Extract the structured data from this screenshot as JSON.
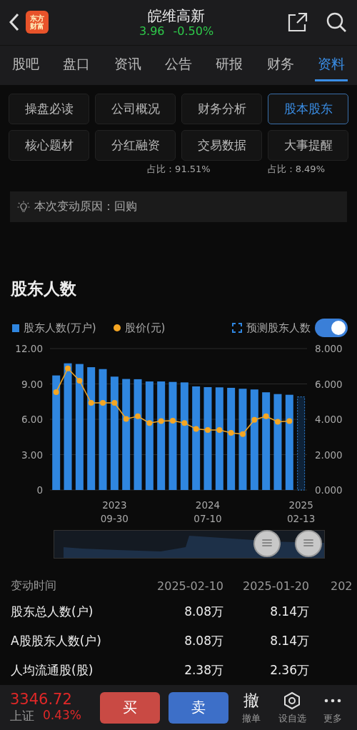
{
  "header": {
    "logo": [
      "东方",
      "财富"
    ],
    "title": "皖维高新",
    "price": "3.96",
    "change": "-0.50%"
  },
  "tabs": [
    {
      "label": "股吧",
      "selected": false
    },
    {
      "label": "盘口",
      "selected": false
    },
    {
      "label": "资讯",
      "selected": false
    },
    {
      "label": "公告",
      "selected": false
    },
    {
      "label": "研报",
      "selected": false
    },
    {
      "label": "财务",
      "selected": false
    },
    {
      "label": "资料",
      "selected": true
    }
  ],
  "sections": [
    {
      "label": "操盘必读",
      "selected": false
    },
    {
      "label": "公司概况",
      "selected": false
    },
    {
      "label": "财务分析",
      "selected": false
    },
    {
      "label": "股本股东",
      "selected": true
    },
    {
      "label": "核心题材",
      "selected": false
    },
    {
      "label": "分红融资",
      "selected": false
    },
    {
      "label": "交易数据",
      "selected": false
    },
    {
      "label": "大事提醒",
      "selected": false
    }
  ],
  "share_ratios": [
    "占比：91.51%",
    "占比：8.49%"
  ],
  "change_reason": "本次变动原因：回购",
  "holders": {
    "title": "股东人数",
    "forecast": {
      "on": true
    },
    "chart_data": {
      "type": "bar",
      "grid": true,
      "categories": [
        null,
        null,
        null,
        null,
        null,
        "2023\n09-30",
        null,
        null,
        null,
        null,
        null,
        null,
        null,
        "2024\n07-10",
        null,
        null,
        null,
        null,
        null,
        null,
        null,
        "2025\n02-13"
      ],
      "ylim": [
        0,
        12
      ],
      "yticks": [
        {
          "value": 0,
          "label": "0"
        },
        {
          "value": 3,
          "label": "3.00"
        },
        {
          "value": 6,
          "label": "6.00"
        },
        {
          "value": 9,
          "label": "9.00"
        },
        {
          "value": 12,
          "label": "12.00"
        }
      ],
      "series": [
        {
          "name": "股东人数(万户)",
          "color": "#2f86e0",
          "values": [
            9.72,
            10.75,
            10.69,
            10.42,
            10.26,
            9.62,
            9.42,
            9.4,
            9.21,
            9.21,
            9.17,
            9.13,
            8.79,
            8.73,
            8.71,
            8.67,
            8.59,
            8.53,
            8.29,
            8.14,
            8.08,
            null
          ]
        },
        {
          "name": "预测股东人数",
          "color": "#2f86e0",
          "values": [
            null,
            null,
            null,
            null,
            null,
            null,
            null,
            null,
            null,
            null,
            null,
            null,
            null,
            null,
            null,
            null,
            null,
            null,
            null,
            null,
            null,
            7.9
          ]
        }
      ]
    },
    "price": {
      "chart_data": {
        "type": "line",
        "ylim": [
          0,
          8
        ],
        "yticks": [
          {
            "value": 0,
            "label": "0.000"
          },
          {
            "value": 2,
            "label": "2.000"
          },
          {
            "value": 4,
            "label": "4.000"
          },
          {
            "value": 6,
            "label": "6.000"
          },
          {
            "value": 8,
            "label": "8.000"
          }
        ],
        "series": [
          {
            "name": "股价(元)",
            "color": "#f5a623",
            "marker": "circle",
            "values": [
              5.54,
              6.88,
              6.18,
              4.93,
              4.93,
              4.93,
              4.02,
              4.17,
              3.79,
              3.9,
              3.92,
              3.79,
              3.45,
              3.39,
              3.39,
              3.23,
              3.16,
              3.97,
              4.17,
              3.86,
              3.9
            ]
          }
        ]
      }
    }
  },
  "table": {
    "columns": [
      "变动时间",
      "2025-02-10",
      "2025-01-20",
      "202"
    ],
    "rows": [
      [
        "股东总人数(户)",
        "8.08万",
        "8.14万"
      ],
      [
        "A股股东人数(户)",
        "8.08万",
        "8.14万"
      ],
      [
        "人均流通股(股)",
        "2.38万",
        "2.36万"
      ]
    ]
  },
  "bottom": {
    "index_value": "3346.72",
    "index_name": "上证",
    "index_change": "0.43%",
    "buy": "买",
    "sell": "卖",
    "actions": [
      {
        "kind": "glyph",
        "glyph": "撤",
        "label": "撤单"
      },
      {
        "kind": "hexagon",
        "label": "设自选"
      },
      {
        "kind": "dots",
        "label": "更多"
      }
    ]
  }
}
